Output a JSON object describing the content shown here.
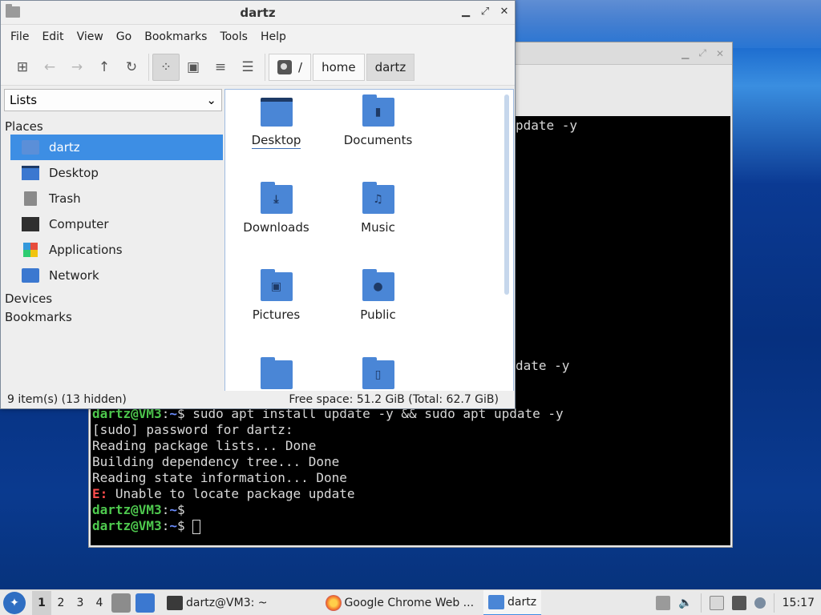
{
  "file_manager": {
    "title": "dartz",
    "menu": [
      "File",
      "Edit",
      "View",
      "Go",
      "Bookmarks",
      "Tools",
      "Help"
    ],
    "toolbar": {
      "icons": [
        "new-tab-icon",
        "back-arrow-icon",
        "forward-arrow-icon",
        "up-arrow-icon",
        "reload-icon",
        "icon-view-icon",
        "thumbnail-view-icon",
        "compact-view-icon",
        "detailed-list-icon"
      ]
    },
    "path": {
      "root_label": "/",
      "segments": [
        "home",
        "dartz"
      ]
    },
    "side_pane_mode": "Lists",
    "places_header": "Places",
    "places": [
      "dartz",
      "Desktop",
      "Trash",
      "Computer",
      "Applications",
      "Network"
    ],
    "devices_header": "Devices",
    "bookmarks_header": "Bookmarks",
    "items": [
      "Desktop",
      "Documents",
      "Downloads",
      "Music",
      "Pictures",
      "Public"
    ],
    "status_left": "9 item(s) (13 hidden)",
    "status_right": "Free space: 51.2 GiB (Total: 62.7 GiB)"
  },
  "terminal": {
    "partial_line_1": "pdate -y",
    "partial_line_2": "date -y",
    "prompt_user": "dartz@VM3",
    "prompt_path": "~",
    "prompt_symbol": "$",
    "command": " sudo apt install update -y && sudo apt update -y",
    "lines": [
      "[sudo] password for dartz:",
      "Reading package lists... Done",
      "Building dependency tree... Done",
      "Reading state information... Done"
    ],
    "error_tag": "E:",
    "error_text": " Unable to locate package update"
  },
  "taskbar": {
    "workspaces": [
      "1",
      "2",
      "3",
      "4"
    ],
    "tasks": [
      "dartz@VM3: ~",
      "Google Chrome Web ...",
      "dartz"
    ],
    "clock": "15:17"
  },
  "colors": {
    "selection": "#3d8ee4",
    "folder": "#4a86d6",
    "prompt_green": "#4ec94e",
    "prompt_blue": "#6b8dff",
    "error_red": "#ff4c4c"
  }
}
